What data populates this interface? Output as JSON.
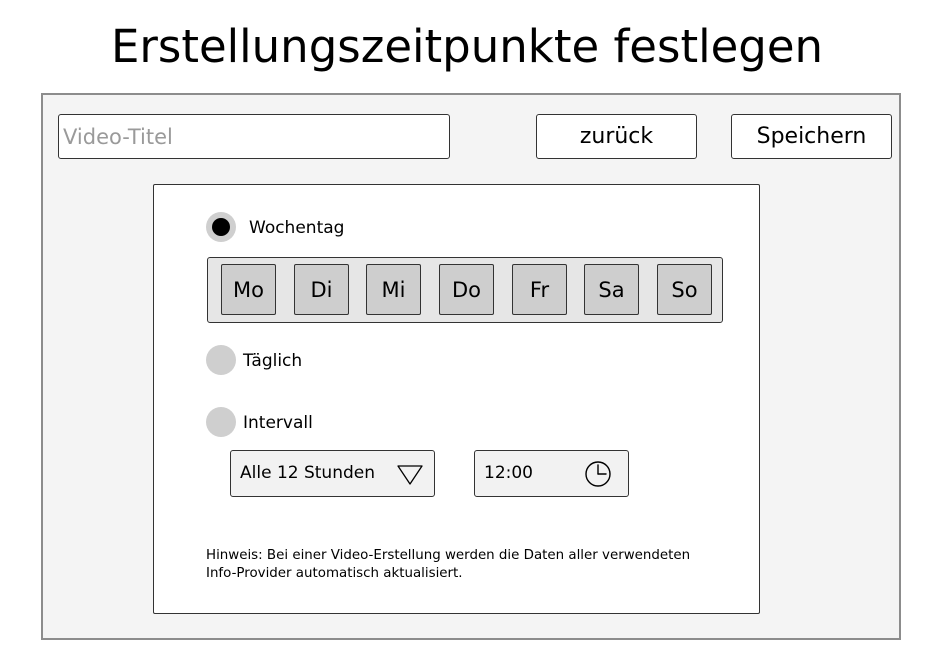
{
  "page": {
    "title": "Erstellungszeitpunkte festlegen"
  },
  "toolbar": {
    "title_placeholder": "Video-Titel",
    "back_label": "zurück",
    "save_label": "Speichern"
  },
  "schedule": {
    "options": [
      {
        "label": "Wochentag",
        "selected": true
      },
      {
        "label": "Täglich",
        "selected": false
      },
      {
        "label": "Intervall",
        "selected": false
      }
    ],
    "weekdays": [
      "Mo",
      "Di",
      "Mi",
      "Do",
      "Fr",
      "Sa",
      "So"
    ],
    "interval": {
      "selected_value": "Alle 12 Stunden"
    },
    "time": {
      "value": "12:00"
    },
    "hint_lines": [
      "Hinweis: Bei einer Video-Erstellung werden die Daten aller verwendeten",
      "Info-Provider automatisch aktualisiert."
    ]
  },
  "icons": {
    "interval_dropdown": "chevron-down-icon",
    "time_picker": "clock-icon"
  },
  "colors": {
    "panel_background": "#f4f4f4",
    "day_button": "#cecece",
    "radio_unchecked": "#cfcfcf",
    "placeholder_text": "#9a9a9a"
  }
}
